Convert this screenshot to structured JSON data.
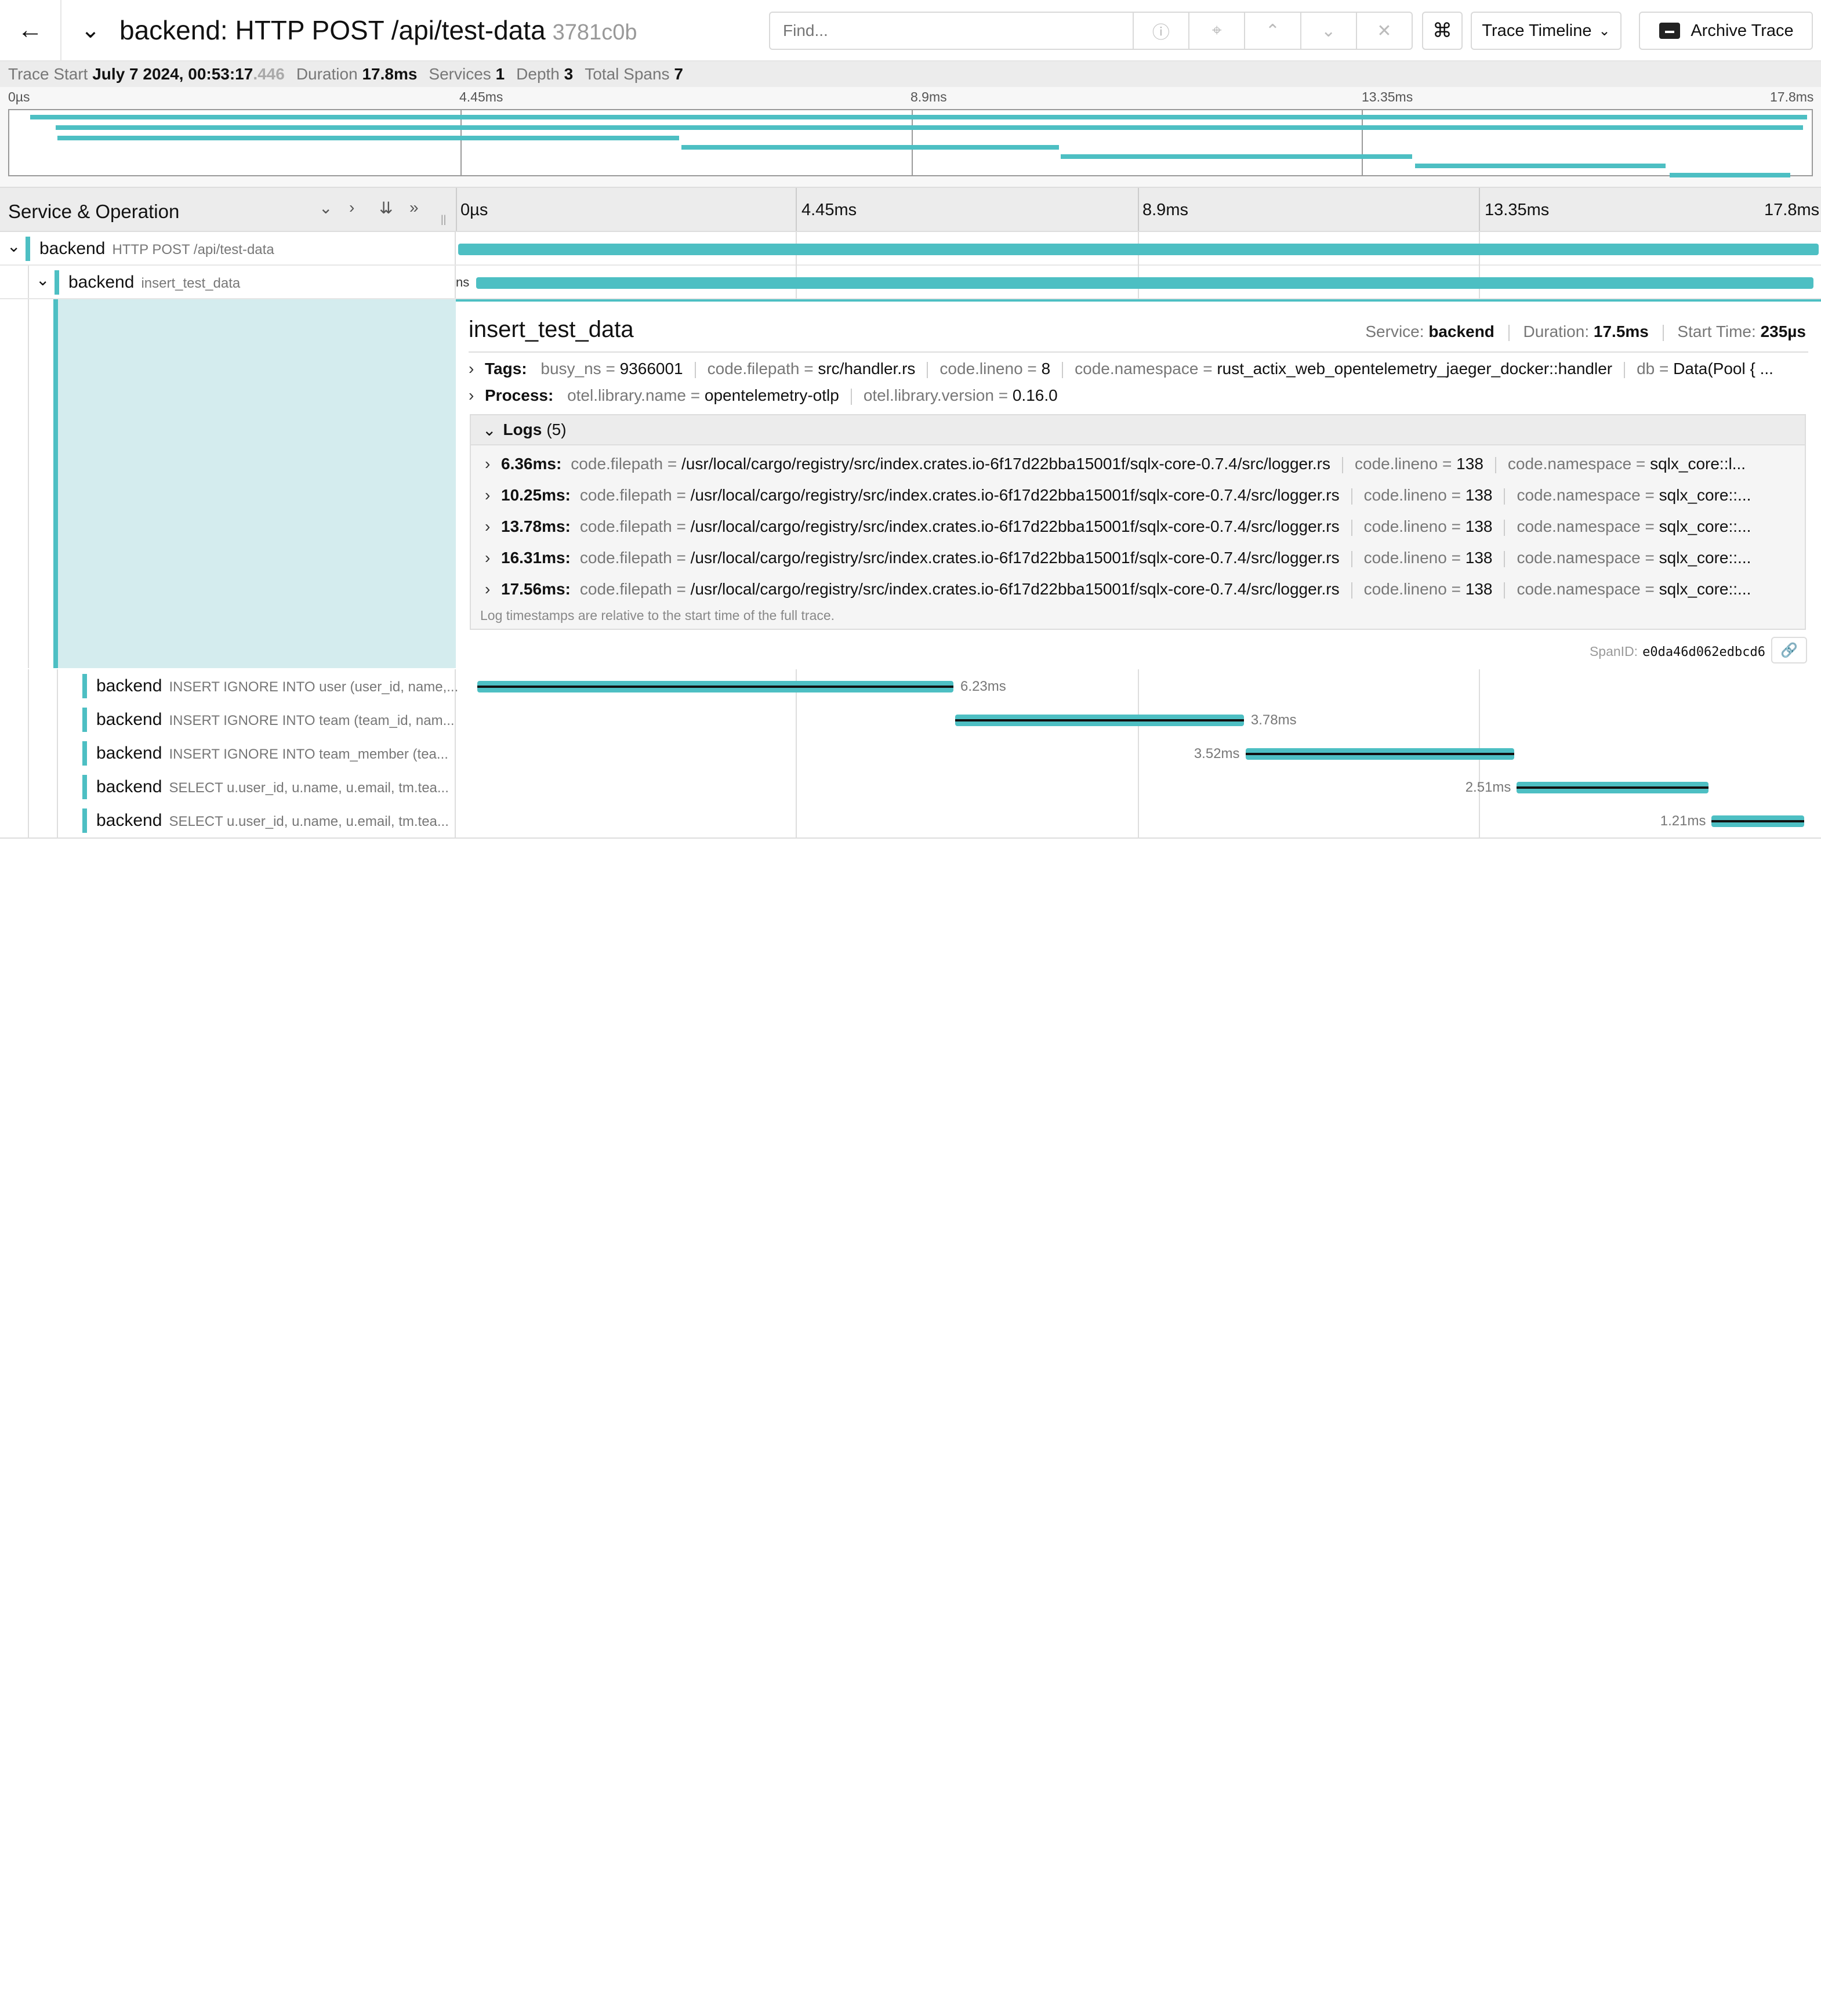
{
  "header": {
    "title": "backend: HTTP POST /api/test-data",
    "trace_id_short": "3781c0b",
    "find_placeholder": "Find...",
    "view_selector": "Trace Timeline",
    "archive_label": "Archive Trace"
  },
  "meta": {
    "trace_start_label": "Trace Start",
    "trace_start_value": "July 7 2024, 00:53:17",
    "trace_start_ms": ".446",
    "duration_label": "Duration",
    "duration_value": "17.8ms",
    "services_label": "Services",
    "services_value": "1",
    "depth_label": "Depth",
    "depth_value": "3",
    "total_spans_label": "Total Spans",
    "total_spans_value": "7"
  },
  "minimap": {
    "ticks": [
      "0µs",
      "4.45ms",
      "8.9ms",
      "13.35ms",
      "17.8ms"
    ]
  },
  "timeline": {
    "column_label": "Service & Operation",
    "ticks": [
      "0µs",
      "4.45ms",
      "8.9ms",
      "13.35ms",
      "17.8ms"
    ],
    "total_ms": 17.8,
    "spans": [
      {
        "service": "backend",
        "operation": "HTTP POST /api/test-data",
        "start_ms": 0,
        "duration_ms": 17.8,
        "depth": 0,
        "duration_label": ""
      },
      {
        "service": "backend",
        "operation": "insert_test_data",
        "start_ms": 0.235,
        "duration_ms": 17.5,
        "depth": 1,
        "duration_label": "ns"
      },
      {
        "service": "backend",
        "operation": "INSERT IGNORE INTO user (user_id, name,...",
        "start_ms": 0.25,
        "duration_ms": 6.23,
        "depth": 2,
        "duration_label": "6.23ms"
      },
      {
        "service": "backend",
        "operation": "INSERT IGNORE INTO team (team_id, nam...",
        "start_ms": 6.5,
        "duration_ms": 3.78,
        "depth": 2,
        "duration_label": "3.78ms"
      },
      {
        "service": "backend",
        "operation": "INSERT IGNORE INTO team_member (tea...",
        "start_ms": 10.3,
        "duration_ms": 3.52,
        "depth": 2,
        "duration_label": "3.52ms"
      },
      {
        "service": "backend",
        "operation": "SELECT u.user_id, u.name, u.email, tm.tea...",
        "start_ms": 13.85,
        "duration_ms": 2.51,
        "depth": 2,
        "duration_label": "2.51ms"
      },
      {
        "service": "backend",
        "operation": "SELECT u.user_id, u.name, u.email, tm.tea...",
        "start_ms": 16.4,
        "duration_ms": 1.21,
        "depth": 2,
        "duration_label": "1.21ms"
      }
    ]
  },
  "detail": {
    "title": "insert_test_data",
    "service_label": "Service:",
    "service_value": "backend",
    "duration_label": "Duration:",
    "duration_value": "17.5ms",
    "start_label": "Start Time:",
    "start_value": "235µs",
    "tags_label": "Tags:",
    "tags": [
      {
        "k": "busy_ns",
        "v": "9366001"
      },
      {
        "k": "code.filepath",
        "v": "src/handler.rs"
      },
      {
        "k": "code.lineno",
        "v": "8"
      },
      {
        "k": "code.namespace",
        "v": "rust_actix_web_opentelemetry_jaeger_docker::handler"
      },
      {
        "k": "db",
        "v": "Data(Pool { ..."
      }
    ],
    "process_label": "Process:",
    "process": [
      {
        "k": "otel.library.name",
        "v": "opentelemetry-otlp"
      },
      {
        "k": "otel.library.version",
        "v": "0.16.0"
      }
    ],
    "logs_label": "Logs",
    "logs_count": "(5)",
    "logs": [
      {
        "ts": "6.36ms:",
        "filepath": "/usr/local/cargo/registry/src/index.crates.io-6f17d22bba15001f/sqlx-core-0.7.4/src/logger.rs",
        "lineno": "138",
        "namespace": "sqlx_core::l..."
      },
      {
        "ts": "10.25ms:",
        "filepath": "/usr/local/cargo/registry/src/index.crates.io-6f17d22bba15001f/sqlx-core-0.7.4/src/logger.rs",
        "lineno": "138",
        "namespace": "sqlx_core::..."
      },
      {
        "ts": "13.78ms:",
        "filepath": "/usr/local/cargo/registry/src/index.crates.io-6f17d22bba15001f/sqlx-core-0.7.4/src/logger.rs",
        "lineno": "138",
        "namespace": "sqlx_core::..."
      },
      {
        "ts": "16.31ms:",
        "filepath": "/usr/local/cargo/registry/src/index.crates.io-6f17d22bba15001f/sqlx-core-0.7.4/src/logger.rs",
        "lineno": "138",
        "namespace": "sqlx_core::..."
      },
      {
        "ts": "17.56ms:",
        "filepath": "/usr/local/cargo/registry/src/index.crates.io-6f17d22bba15001f/sqlx-core-0.7.4/src/logger.rs",
        "lineno": "138",
        "namespace": "sqlx_core::..."
      }
    ],
    "log_key_filepath": "code.filepath",
    "log_key_lineno": "code.lineno",
    "log_key_namespace": "code.namespace",
    "logs_note": "Log timestamps are relative to the start time of the full trace.",
    "span_id_label": "SpanID:",
    "span_id": "e0da46d062edbcd6"
  },
  "colors": {
    "accent": "#4dbfc3",
    "selected_bg": "#d4ecee"
  }
}
